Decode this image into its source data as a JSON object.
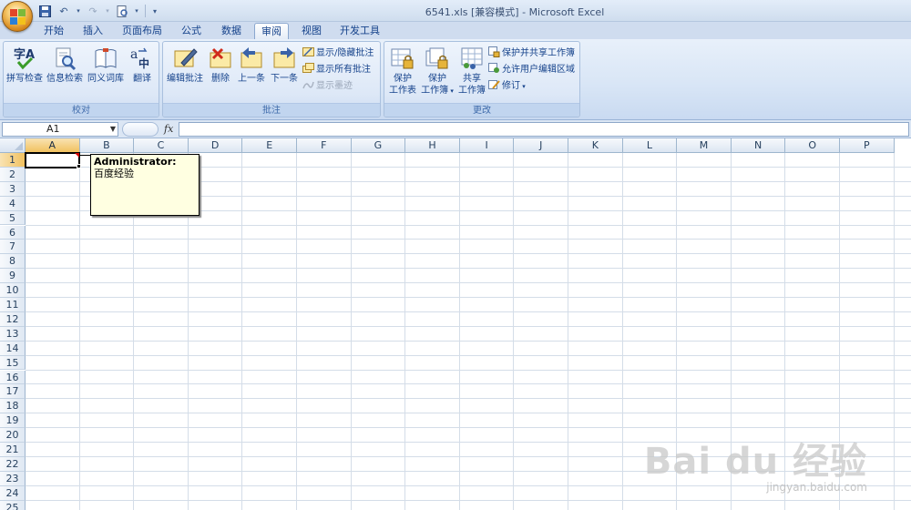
{
  "window": {
    "title": "6541.xls  [兼容模式] - Microsoft Excel"
  },
  "tabs": [
    {
      "label": "开始",
      "active": false
    },
    {
      "label": "插入",
      "active": false
    },
    {
      "label": "页面布局",
      "active": false
    },
    {
      "label": "公式",
      "active": false
    },
    {
      "label": "数据",
      "active": false
    },
    {
      "label": "审阅",
      "active": true
    },
    {
      "label": "视图",
      "active": false
    },
    {
      "label": "开发工具",
      "active": false
    }
  ],
  "ribbon": {
    "proofing": {
      "label": "校对",
      "buttons": {
        "spelling": "拼写检查",
        "research": "信息检索",
        "thesaurus": "同义词库",
        "translate": "翻译"
      }
    },
    "comments": {
      "label": "批注",
      "buttons": {
        "edit": "编辑批注",
        "delete": "删除",
        "previous": "上一条",
        "next": "下一条",
        "show_hide": "显示/隐藏批注",
        "show_all": "显示所有批注",
        "show_ink": "显示墨迹"
      }
    },
    "changes": {
      "label": "更改",
      "buttons": {
        "protect_sheet_1": "保护",
        "protect_sheet_2": "工作表",
        "protect_book_1": "保护",
        "protect_book_2": "工作簿",
        "share_book_1": "共享",
        "share_book_2": "工作簿",
        "protect_share": "保护并共享工作簿",
        "allow_edit": "允许用户编辑区域",
        "track_changes": "修订"
      }
    }
  },
  "formula_bar": {
    "name_box": "A1",
    "fx": "fx",
    "formula": ""
  },
  "grid": {
    "columns": [
      "A",
      "B",
      "C",
      "D",
      "E",
      "F",
      "G",
      "H",
      "I",
      "J",
      "K",
      "L",
      "M",
      "N",
      "O",
      "P"
    ],
    "rows": [
      "1",
      "2",
      "3",
      "4",
      "5",
      "6",
      "7",
      "8",
      "9",
      "10",
      "11",
      "12",
      "13",
      "14",
      "15",
      "16",
      "17",
      "18",
      "19",
      "20",
      "21",
      "22",
      "23",
      "24",
      "25"
    ],
    "selected_cell": "A1"
  },
  "comment": {
    "author": "Administrator:",
    "text": "百度经验"
  },
  "watermark": {
    "logo": "Bai du 经验",
    "url": "jingyan.baidu.com"
  },
  "colors": {
    "accent": "#15428b",
    "selected_header": "#f1c15f",
    "comment_bg": "#ffffe1"
  }
}
